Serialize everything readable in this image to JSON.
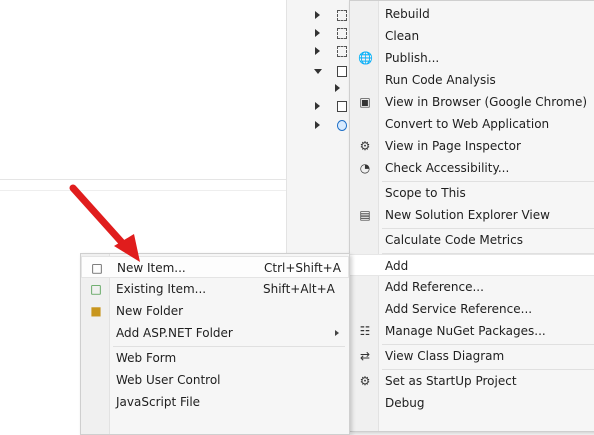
{
  "main_menu": {
    "items": [
      {
        "label": "Rebuild",
        "icon": "none"
      },
      {
        "label": "Clean",
        "icon": "none"
      },
      {
        "label": "Publish...",
        "icon": "publish-globe-icon"
      },
      {
        "label": "Run Code Analysis",
        "icon": "none"
      },
      {
        "label": "View in Browser (Google Chrome)",
        "icon": "view-browser-icon"
      },
      {
        "label": "Convert to Web Application",
        "icon": "none"
      },
      {
        "label": "View in Page Inspector",
        "icon": "page-inspector-icon"
      },
      {
        "label": "Check Accessibility...",
        "icon": "accessibility-icon"
      },
      {
        "label": "Scope to This",
        "icon": "none"
      },
      {
        "label": "New Solution Explorer View",
        "icon": "solution-explorer-view-icon"
      },
      {
        "label": "Calculate Code Metrics",
        "icon": "none"
      },
      {
        "label": "Add",
        "icon": "none"
      },
      {
        "label": "Add Reference...",
        "icon": "none"
      },
      {
        "label": "Add Service Reference...",
        "icon": "none"
      },
      {
        "label": "Manage NuGet Packages...",
        "icon": "nuget-icon"
      },
      {
        "label": "View Class Diagram",
        "icon": "class-diagram-icon"
      },
      {
        "label": "Set as StartUp Project",
        "icon": "gear-icon"
      },
      {
        "label": "Debug",
        "icon": "none"
      }
    ]
  },
  "sub_menu": {
    "items": [
      {
        "label": "New Item...",
        "shortcut": "Ctrl+Shift+A",
        "icon": "new-item-icon"
      },
      {
        "label": "Existing Item...",
        "shortcut": "Shift+Alt+A",
        "icon": "existing-item-icon"
      },
      {
        "label": "New Folder",
        "shortcut": "",
        "icon": "new-folder-icon"
      },
      {
        "label": "Add ASP.NET Folder",
        "shortcut": "",
        "icon": "none"
      },
      {
        "label": "Web Form",
        "shortcut": "",
        "icon": "none"
      },
      {
        "label": "Web User Control",
        "shortcut": "",
        "icon": "none"
      },
      {
        "label": "JavaScript File",
        "shortcut": "",
        "icon": "none"
      }
    ]
  },
  "colors": {
    "arrow": "#e01d1d",
    "menu_bg": "#f6f6f6",
    "highlight": "#ffffff"
  }
}
